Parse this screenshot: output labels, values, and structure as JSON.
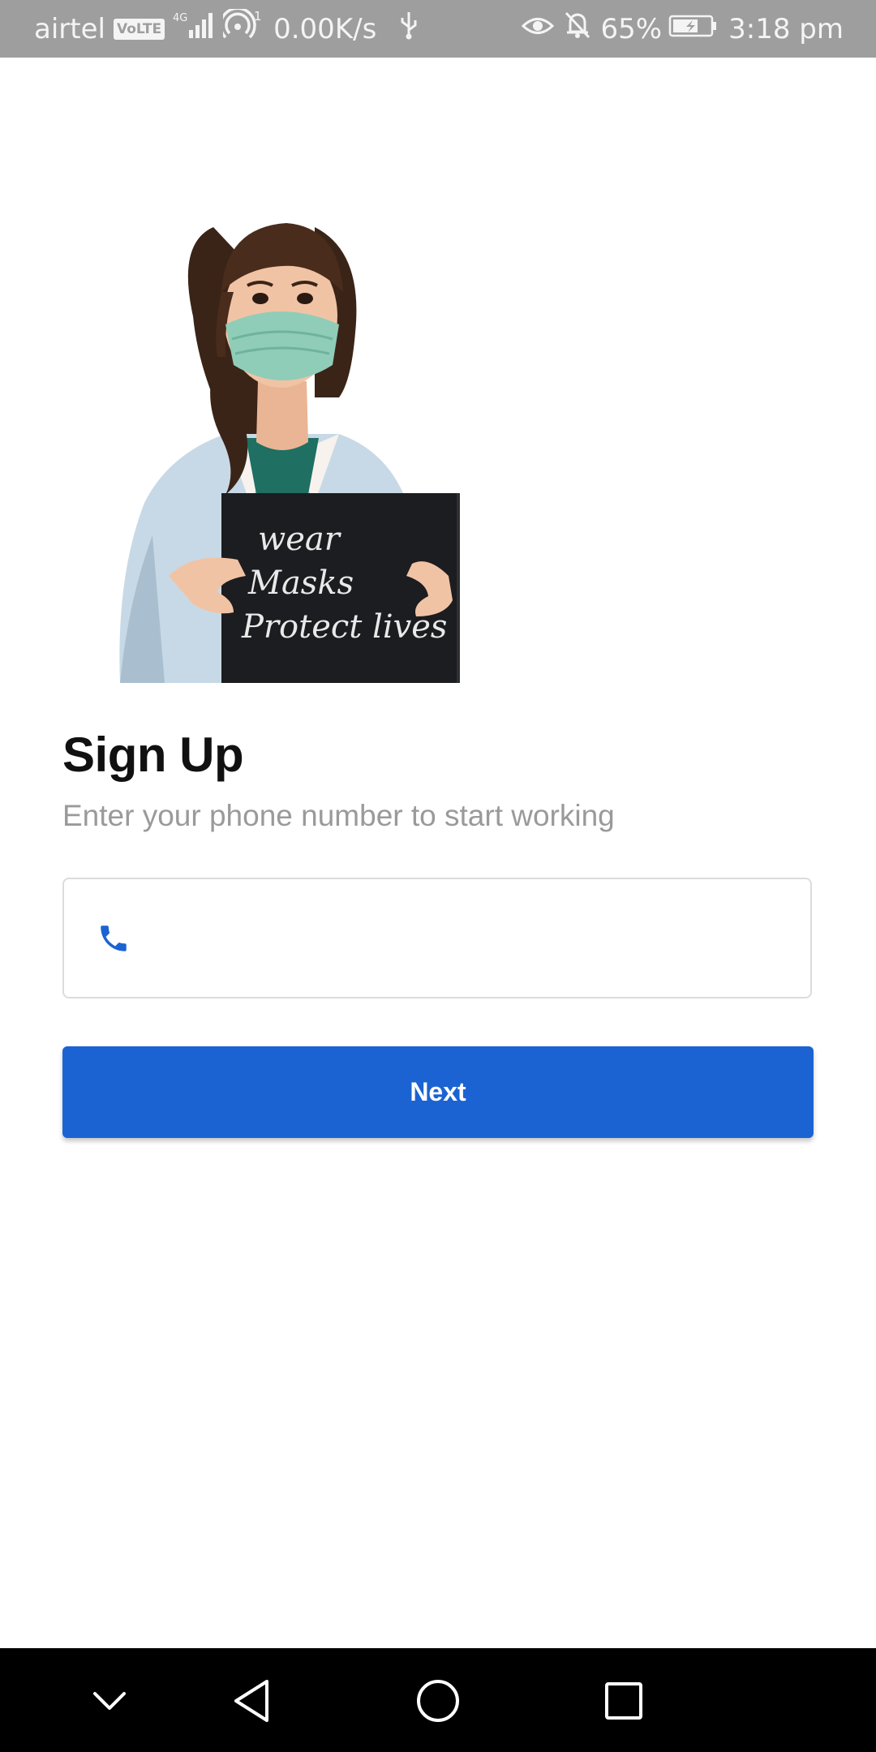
{
  "status_bar": {
    "carrier": "airtel",
    "volte": "VoLTE",
    "network": "4G",
    "hotspot_count": "1",
    "speed": "0.00K/s",
    "battery": "65%",
    "time": "3:18 pm",
    "icons": [
      "volte-icon",
      "signal-icon",
      "hotspot-icon",
      "usb-icon",
      "eye-icon",
      "bell-off-icon",
      "battery-charging-icon"
    ]
  },
  "illustration": {
    "sign_lines": [
      "wear",
      "Masks",
      "Protect lives"
    ]
  },
  "signup": {
    "title": "Sign Up",
    "subtitle": "Enter your phone number to start working",
    "phone_placeholder": "",
    "phone_icon": "phone-icon",
    "next_label": "Next"
  },
  "colors": {
    "primary": "#1b63d3",
    "status_bar": "#9e9e9e",
    "subtitle": "#9a9a9a",
    "nav_bar": "#000000"
  },
  "nav_bar": {
    "icons": [
      "chevron-down-icon",
      "back-icon",
      "home-icon",
      "recents-icon"
    ]
  }
}
